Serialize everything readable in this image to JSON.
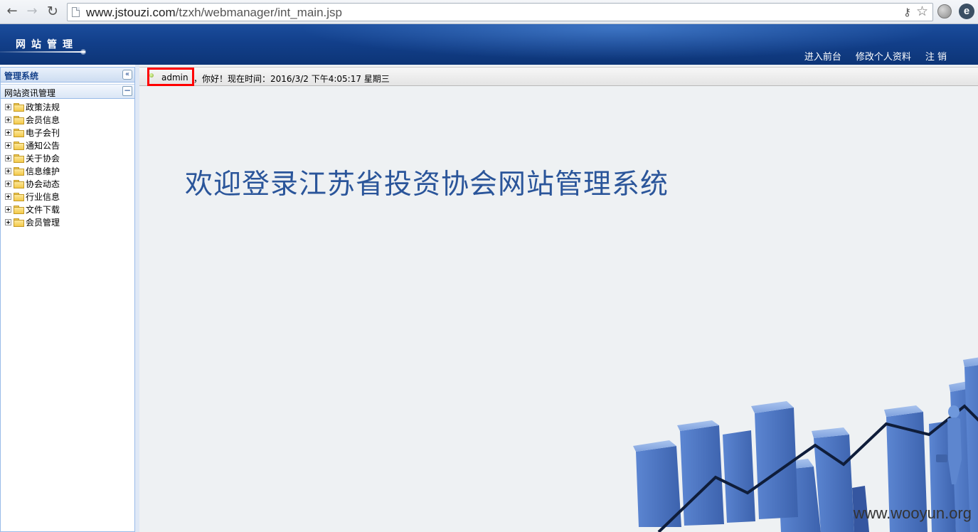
{
  "browser": {
    "url_host": "www.jstouzi.com",
    "url_path": "/tzxh/webmanager/int_main.jsp"
  },
  "header": {
    "site_title": "网站管理",
    "links": [
      "进入前台",
      "修改个人资料",
      "注 销"
    ]
  },
  "sidebar": {
    "title": "管理系统",
    "section_title": "网站资讯管理",
    "items": [
      "政策法规",
      "会员信息",
      "电子会刊",
      "通知公告",
      "关于协会",
      "信息维护",
      "协会动态",
      "行业信息",
      "文件下载",
      "会员管理"
    ]
  },
  "status": {
    "username": "admin",
    "greeting": "，你好！现在时间：2016/3/2 下午4:05:17 星期三"
  },
  "main": {
    "welcome_text": "欢迎登录江苏省投资协会网站管理系统"
  },
  "watermark": "www.wooyun.org",
  "colors": {
    "banner": "#123f8a",
    "highlight_box": "#ff0000",
    "welcome_text": "#2a559a",
    "bars": "#4a74c4"
  }
}
